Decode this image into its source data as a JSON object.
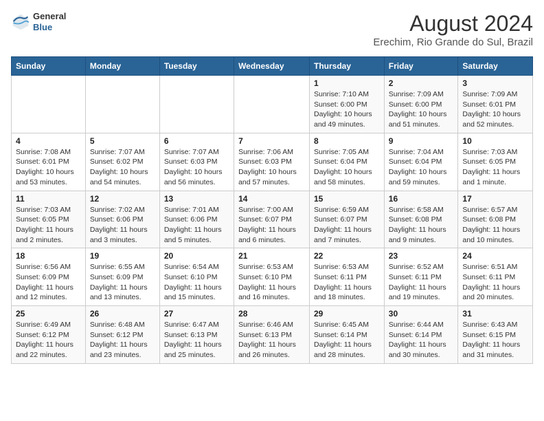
{
  "header": {
    "logo_general": "General",
    "logo_blue": "Blue",
    "title": "August 2024",
    "subtitle": "Erechim, Rio Grande do Sul, Brazil"
  },
  "days_of_week": [
    "Sunday",
    "Monday",
    "Tuesday",
    "Wednesday",
    "Thursday",
    "Friday",
    "Saturday"
  ],
  "weeks": [
    [
      {
        "day": "",
        "sunrise": "",
        "sunset": "",
        "daylight": ""
      },
      {
        "day": "",
        "sunrise": "",
        "sunset": "",
        "daylight": ""
      },
      {
        "day": "",
        "sunrise": "",
        "sunset": "",
        "daylight": ""
      },
      {
        "day": "",
        "sunrise": "",
        "sunset": "",
        "daylight": ""
      },
      {
        "day": "1",
        "sunrise": "Sunrise: 7:10 AM",
        "sunset": "Sunset: 6:00 PM",
        "daylight": "Daylight: 10 hours and 49 minutes."
      },
      {
        "day": "2",
        "sunrise": "Sunrise: 7:09 AM",
        "sunset": "Sunset: 6:00 PM",
        "daylight": "Daylight: 10 hours and 51 minutes."
      },
      {
        "day": "3",
        "sunrise": "Sunrise: 7:09 AM",
        "sunset": "Sunset: 6:01 PM",
        "daylight": "Daylight: 10 hours and 52 minutes."
      }
    ],
    [
      {
        "day": "4",
        "sunrise": "Sunrise: 7:08 AM",
        "sunset": "Sunset: 6:01 PM",
        "daylight": "Daylight: 10 hours and 53 minutes."
      },
      {
        "day": "5",
        "sunrise": "Sunrise: 7:07 AM",
        "sunset": "Sunset: 6:02 PM",
        "daylight": "Daylight: 10 hours and 54 minutes."
      },
      {
        "day": "6",
        "sunrise": "Sunrise: 7:07 AM",
        "sunset": "Sunset: 6:03 PM",
        "daylight": "Daylight: 10 hours and 56 minutes."
      },
      {
        "day": "7",
        "sunrise": "Sunrise: 7:06 AM",
        "sunset": "Sunset: 6:03 PM",
        "daylight": "Daylight: 10 hours and 57 minutes."
      },
      {
        "day": "8",
        "sunrise": "Sunrise: 7:05 AM",
        "sunset": "Sunset: 6:04 PM",
        "daylight": "Daylight: 10 hours and 58 minutes."
      },
      {
        "day": "9",
        "sunrise": "Sunrise: 7:04 AM",
        "sunset": "Sunset: 6:04 PM",
        "daylight": "Daylight: 10 hours and 59 minutes."
      },
      {
        "day": "10",
        "sunrise": "Sunrise: 7:03 AM",
        "sunset": "Sunset: 6:05 PM",
        "daylight": "Daylight: 11 hours and 1 minute."
      }
    ],
    [
      {
        "day": "11",
        "sunrise": "Sunrise: 7:03 AM",
        "sunset": "Sunset: 6:05 PM",
        "daylight": "Daylight: 11 hours and 2 minutes."
      },
      {
        "day": "12",
        "sunrise": "Sunrise: 7:02 AM",
        "sunset": "Sunset: 6:06 PM",
        "daylight": "Daylight: 11 hours and 3 minutes."
      },
      {
        "day": "13",
        "sunrise": "Sunrise: 7:01 AM",
        "sunset": "Sunset: 6:06 PM",
        "daylight": "Daylight: 11 hours and 5 minutes."
      },
      {
        "day": "14",
        "sunrise": "Sunrise: 7:00 AM",
        "sunset": "Sunset: 6:07 PM",
        "daylight": "Daylight: 11 hours and 6 minutes."
      },
      {
        "day": "15",
        "sunrise": "Sunrise: 6:59 AM",
        "sunset": "Sunset: 6:07 PM",
        "daylight": "Daylight: 11 hours and 7 minutes."
      },
      {
        "day": "16",
        "sunrise": "Sunrise: 6:58 AM",
        "sunset": "Sunset: 6:08 PM",
        "daylight": "Daylight: 11 hours and 9 minutes."
      },
      {
        "day": "17",
        "sunrise": "Sunrise: 6:57 AM",
        "sunset": "Sunset: 6:08 PM",
        "daylight": "Daylight: 11 hours and 10 minutes."
      }
    ],
    [
      {
        "day": "18",
        "sunrise": "Sunrise: 6:56 AM",
        "sunset": "Sunset: 6:09 PM",
        "daylight": "Daylight: 11 hours and 12 minutes."
      },
      {
        "day": "19",
        "sunrise": "Sunrise: 6:55 AM",
        "sunset": "Sunset: 6:09 PM",
        "daylight": "Daylight: 11 hours and 13 minutes."
      },
      {
        "day": "20",
        "sunrise": "Sunrise: 6:54 AM",
        "sunset": "Sunset: 6:10 PM",
        "daylight": "Daylight: 11 hours and 15 minutes."
      },
      {
        "day": "21",
        "sunrise": "Sunrise: 6:53 AM",
        "sunset": "Sunset: 6:10 PM",
        "daylight": "Daylight: 11 hours and 16 minutes."
      },
      {
        "day": "22",
        "sunrise": "Sunrise: 6:53 AM",
        "sunset": "Sunset: 6:11 PM",
        "daylight": "Daylight: 11 hours and 18 minutes."
      },
      {
        "day": "23",
        "sunrise": "Sunrise: 6:52 AM",
        "sunset": "Sunset: 6:11 PM",
        "daylight": "Daylight: 11 hours and 19 minutes."
      },
      {
        "day": "24",
        "sunrise": "Sunrise: 6:51 AM",
        "sunset": "Sunset: 6:11 PM",
        "daylight": "Daylight: 11 hours and 20 minutes."
      }
    ],
    [
      {
        "day": "25",
        "sunrise": "Sunrise: 6:49 AM",
        "sunset": "Sunset: 6:12 PM",
        "daylight": "Daylight: 11 hours and 22 minutes."
      },
      {
        "day": "26",
        "sunrise": "Sunrise: 6:48 AM",
        "sunset": "Sunset: 6:12 PM",
        "daylight": "Daylight: 11 hours and 23 minutes."
      },
      {
        "day": "27",
        "sunrise": "Sunrise: 6:47 AM",
        "sunset": "Sunset: 6:13 PM",
        "daylight": "Daylight: 11 hours and 25 minutes."
      },
      {
        "day": "28",
        "sunrise": "Sunrise: 6:46 AM",
        "sunset": "Sunset: 6:13 PM",
        "daylight": "Daylight: 11 hours and 26 minutes."
      },
      {
        "day": "29",
        "sunrise": "Sunrise: 6:45 AM",
        "sunset": "Sunset: 6:14 PM",
        "daylight": "Daylight: 11 hours and 28 minutes."
      },
      {
        "day": "30",
        "sunrise": "Sunrise: 6:44 AM",
        "sunset": "Sunset: 6:14 PM",
        "daylight": "Daylight: 11 hours and 30 minutes."
      },
      {
        "day": "31",
        "sunrise": "Sunrise: 6:43 AM",
        "sunset": "Sunset: 6:15 PM",
        "daylight": "Daylight: 11 hours and 31 minutes."
      }
    ]
  ]
}
